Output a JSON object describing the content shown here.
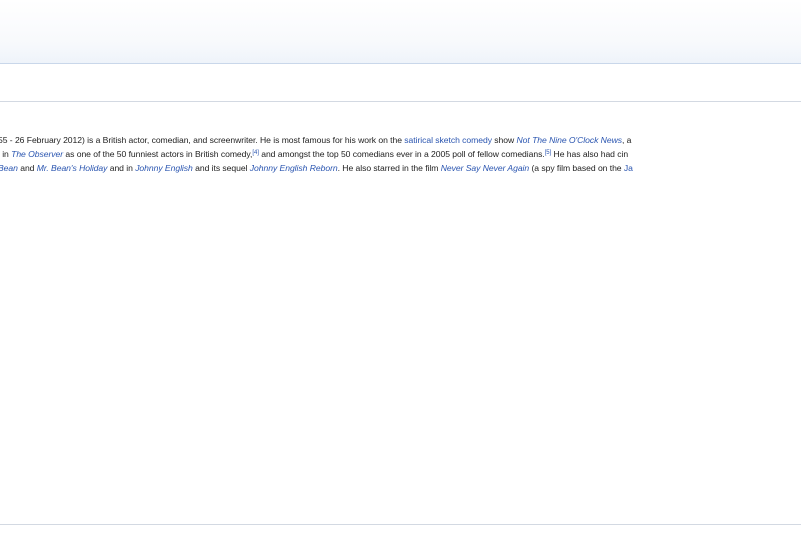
{
  "article": {
    "line1": {
      "t1": "55 - 26 February 2012) is a British actor, comedian, and screenwriter. He is most famous for his work on the ",
      "l1": "satirical sketch comedy",
      "t2": " show ",
      "l2": "Not The Nine O'Clock News",
      "t3": ", a"
    },
    "line2": {
      "t1": "l in ",
      "l1": "The Observer",
      "t2": " as one of the 50 funniest actors in British comedy,",
      "ref1": "[4]",
      "t3": " and amongst the top 50 comedians ever in a 2005 poll of fellow comedians.",
      "ref2": "[5]",
      "t4": " He has also had cin"
    },
    "line3": {
      "l1": "Bean",
      "t1": " and ",
      "l2": "Mr. Bean's Holiday",
      "t2": " and in ",
      "l3": "Johnny English",
      "t3": " and its sequel ",
      "l4": "Johnny English Reborn",
      "t4": ". He also starred in the film ",
      "l5": "Never Say Never Again",
      "t5": " (a spy film based on the ",
      "l6": "Ja"
    }
  },
  "colors": {
    "link": "#2a55b0",
    "text": "#222222",
    "rule": "#d3d9e2"
  }
}
